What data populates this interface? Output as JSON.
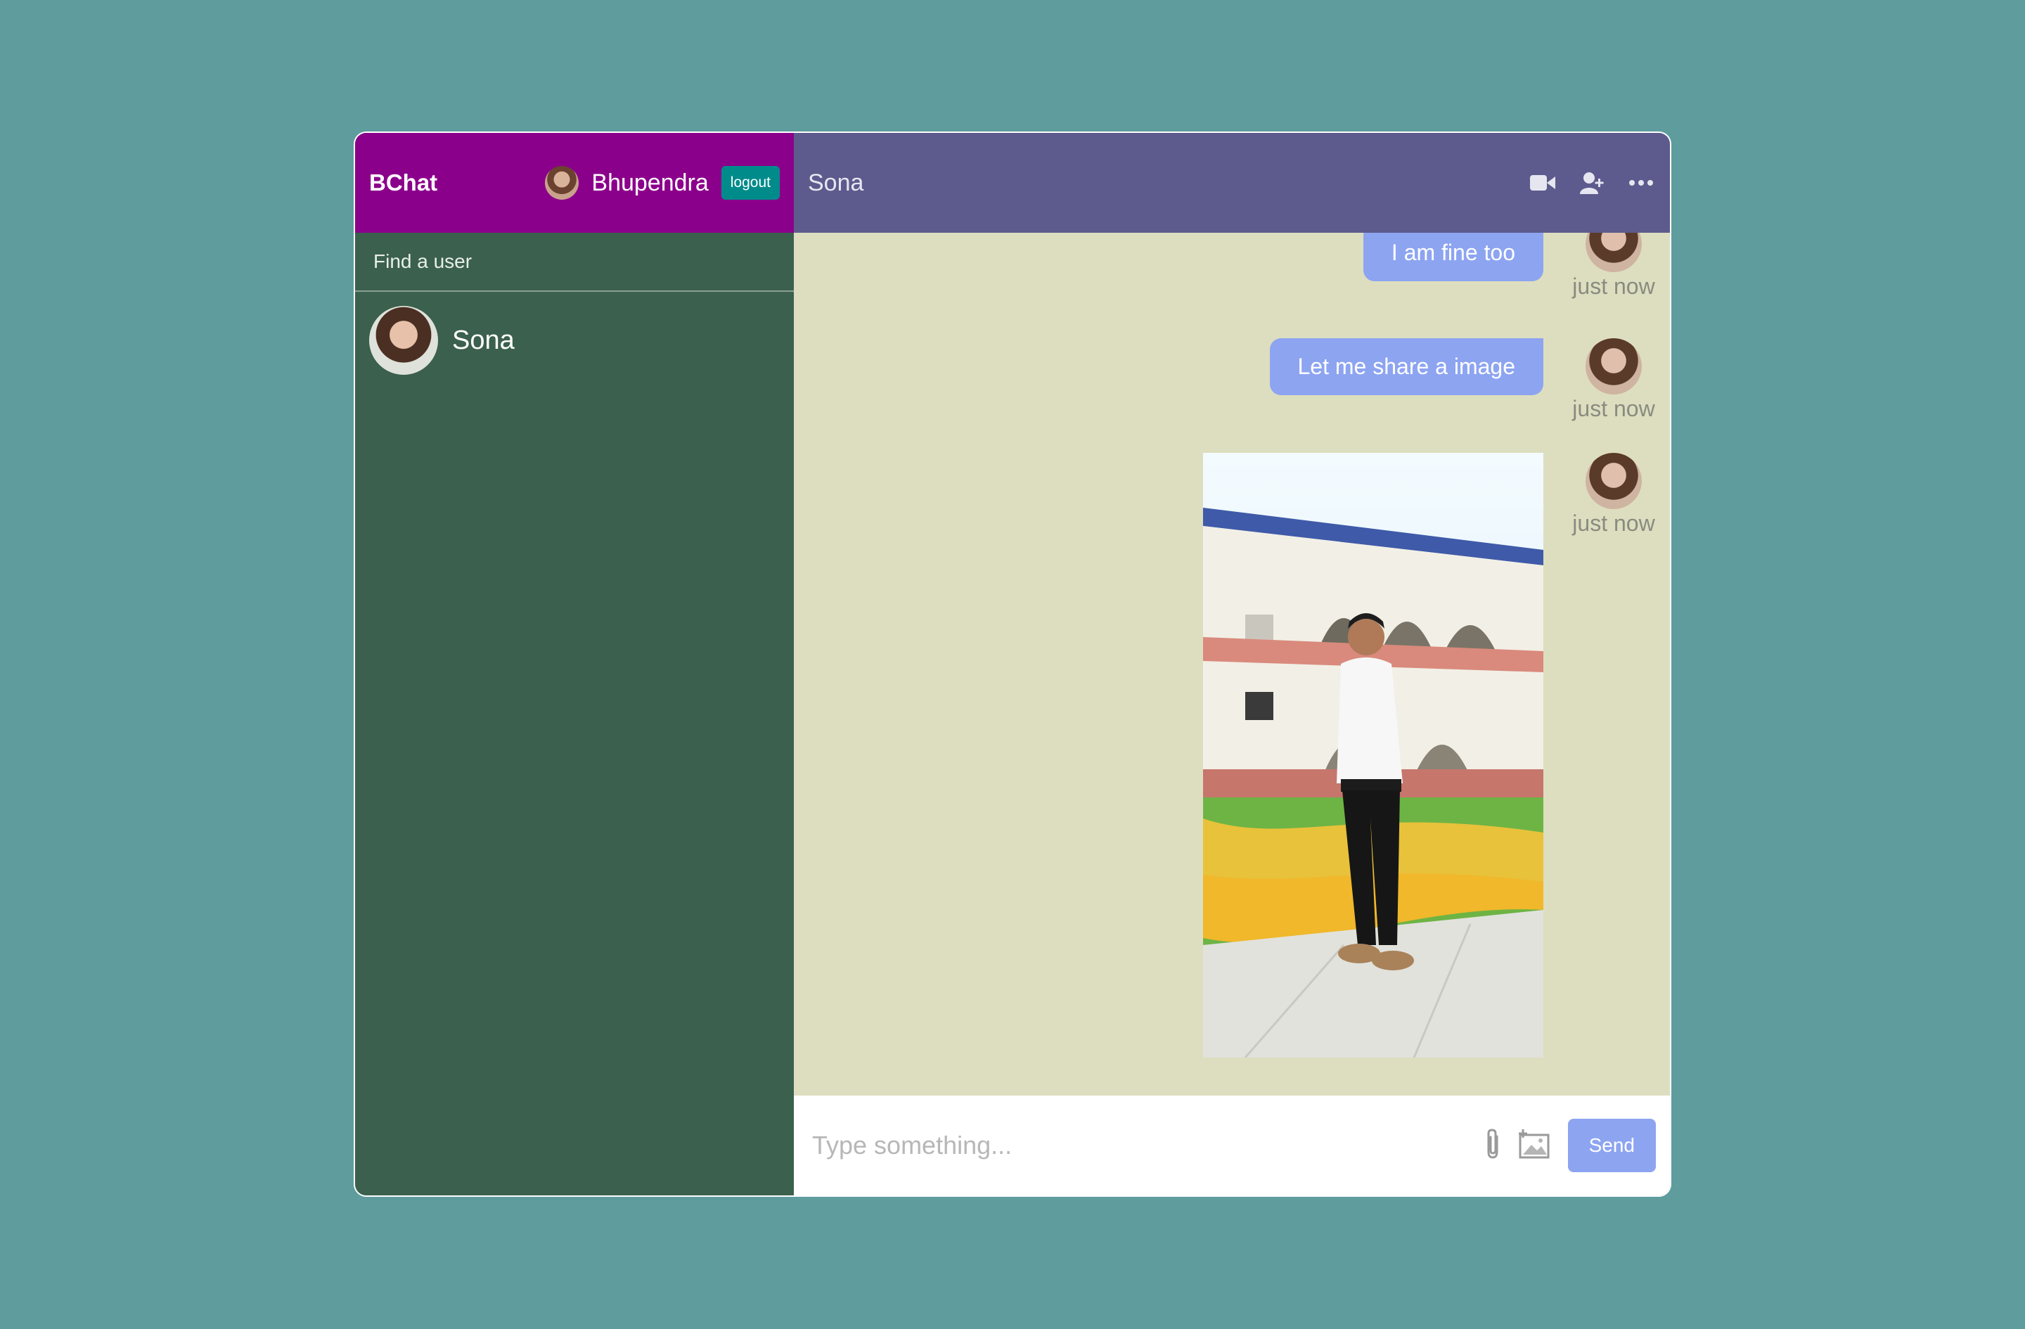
{
  "app": {
    "logo": "BChat",
    "current_user": "Bhupendra",
    "logout_label": "logout"
  },
  "sidebar": {
    "search_placeholder": "Find a user",
    "chats": [
      {
        "name": "Sona"
      }
    ]
  },
  "chat": {
    "title": "Sona",
    "icons": [
      "video-camera-icon",
      "add-user-icon",
      "more-options-icon"
    ],
    "messages": [
      {
        "text": "I am fine too",
        "time": "just now"
      },
      {
        "text": "Let me share a image",
        "time": "just now"
      },
      {
        "image": "shared-photo",
        "time": "just now"
      }
    ]
  },
  "input": {
    "placeholder": "Type something...",
    "send_label": "Send"
  },
  "colors": {
    "background": "#5f9c9e",
    "sidebar": "#3b604d",
    "navbar": "#8b008b",
    "chat_header": "#5d5b8d",
    "chat_bg": "#dddebf",
    "bubble": "#8da4f1",
    "logout": "#008b8b"
  }
}
